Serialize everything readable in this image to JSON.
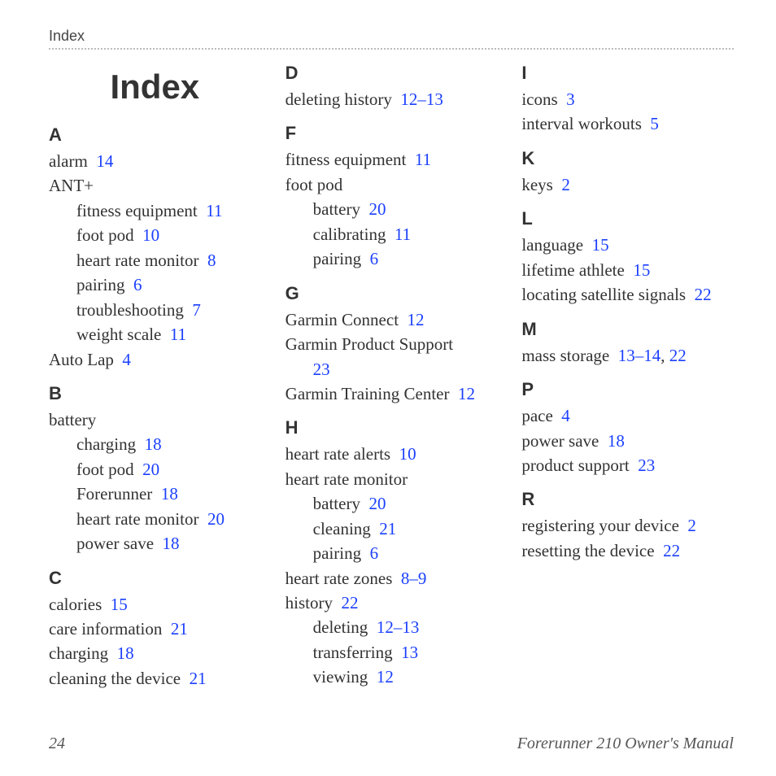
{
  "runningHead": "Index",
  "title": "Index",
  "pageNumber": "24",
  "manualTitle": "Forerunner 210 Owner's Manual",
  "sections": {
    "A": {
      "letter": "A",
      "e0": {
        "t": "alarm",
        "p": "14"
      },
      "e1": {
        "t": "ANT+"
      },
      "e1s0": {
        "t": "fitness equipment",
        "p": "11"
      },
      "e1s1": {
        "t": "foot pod",
        "p": "10"
      },
      "e1s2": {
        "t": "heart rate monitor",
        "p": "8"
      },
      "e1s3": {
        "t": "pairing",
        "p": "6"
      },
      "e1s4": {
        "t": "troubleshooting",
        "p": "7"
      },
      "e1s5": {
        "t": "weight scale",
        "p": "11"
      },
      "e2": {
        "t": "Auto Lap",
        "p": "4"
      }
    },
    "B": {
      "letter": "B",
      "e0": {
        "t": "battery"
      },
      "e0s0": {
        "t": "charging",
        "p": "18"
      },
      "e0s1": {
        "t": "foot pod",
        "p": "20"
      },
      "e0s2": {
        "t": "Forerunner",
        "p": "18"
      },
      "e0s3": {
        "t": "heart rate monitor",
        "p": "20"
      },
      "e0s4": {
        "t": "power save",
        "p": "18"
      }
    },
    "C": {
      "letter": "C",
      "e0": {
        "t": "calories",
        "p": "15"
      },
      "e1": {
        "t": "care information",
        "p": "21"
      },
      "e2": {
        "t": "charging",
        "p": "18"
      },
      "e3": {
        "t": "cleaning the device",
        "p": "21"
      }
    },
    "D": {
      "letter": "D",
      "e0": {
        "t": "deleting history",
        "p": "12–13"
      }
    },
    "F": {
      "letter": "F",
      "e0": {
        "t": "fitness equipment",
        "p": "11"
      },
      "e1": {
        "t": "foot pod"
      },
      "e1s0": {
        "t": "battery",
        "p": "20"
      },
      "e1s1": {
        "t": "calibrating",
        "p": "11"
      },
      "e1s2": {
        "t": "pairing",
        "p": "6"
      }
    },
    "G": {
      "letter": "G",
      "e0": {
        "t": "Garmin Connect",
        "p": "12"
      },
      "e1": {
        "t": "Garmin Product Support",
        "p": "23"
      },
      "e2": {
        "t": "Garmin Training Center",
        "p": "12"
      }
    },
    "H": {
      "letter": "H",
      "e0": {
        "t": "heart rate alerts",
        "p": "10"
      },
      "e1": {
        "t": "heart rate monitor"
      },
      "e1s0": {
        "t": "battery",
        "p": "20"
      },
      "e1s1": {
        "t": "cleaning",
        "p": "21"
      },
      "e1s2": {
        "t": "pairing",
        "p": "6"
      },
      "e2": {
        "t": "heart rate zones",
        "p": "8–9"
      },
      "e3": {
        "t": "history",
        "p": "22"
      },
      "e3s0": {
        "t": "deleting",
        "p": "12–13"
      },
      "e3s1": {
        "t": "transferring",
        "p": "13"
      },
      "e3s2": {
        "t": "viewing",
        "p": "12"
      }
    },
    "I": {
      "letter": "I",
      "e0": {
        "t": "icons",
        "p": "3"
      },
      "e1": {
        "t": "interval workouts",
        "p": "5"
      }
    },
    "K": {
      "letter": "K",
      "e0": {
        "t": "keys",
        "p": "2"
      }
    },
    "L": {
      "letter": "L",
      "e0": {
        "t": "language",
        "p": "15"
      },
      "e1": {
        "t": "lifetime athlete",
        "p": "15"
      },
      "e2": {
        "t": "locating satellite signals",
        "p": "22"
      }
    },
    "M": {
      "letter": "M",
      "e0": {
        "t": "mass storage",
        "p1": "13–14",
        "p2": "22"
      }
    },
    "P": {
      "letter": "P",
      "e0": {
        "t": "pace",
        "p": "4"
      },
      "e1": {
        "t": "power save",
        "p": "18"
      },
      "e2": {
        "t": "product support",
        "p": "23"
      }
    },
    "R": {
      "letter": "R",
      "e0": {
        "t": "registering your device",
        "p": "2"
      },
      "e1": {
        "t": "resetting the device",
        "p": "22"
      }
    }
  }
}
